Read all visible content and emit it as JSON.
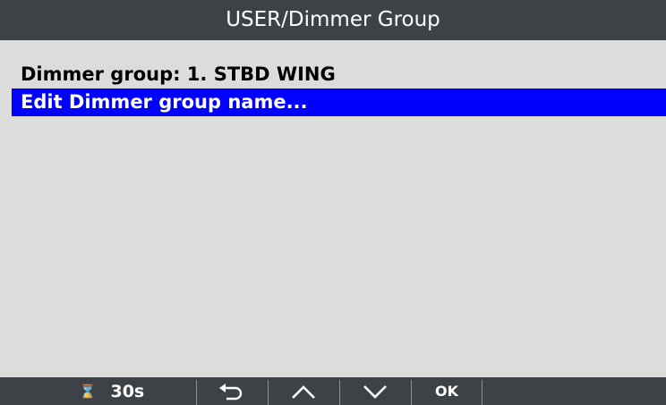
{
  "header": {
    "title": "USER/Dimmer Group"
  },
  "menu": {
    "items": [
      {
        "label": "Dimmer group: 1. STBD WING",
        "selected": false
      },
      {
        "label": "Edit Dimmer group name...",
        "selected": true
      }
    ]
  },
  "footer": {
    "timer_icon": "hourglass-icon",
    "timer_value": "30s",
    "back_icon": "back-arrow-icon",
    "up_icon": "chevron-up-icon",
    "down_icon": "chevron-down-icon",
    "ok_label": "OK"
  },
  "colors": {
    "bar": "#3d4247",
    "background": "#dcdcdc",
    "selection": "#0000ff"
  }
}
